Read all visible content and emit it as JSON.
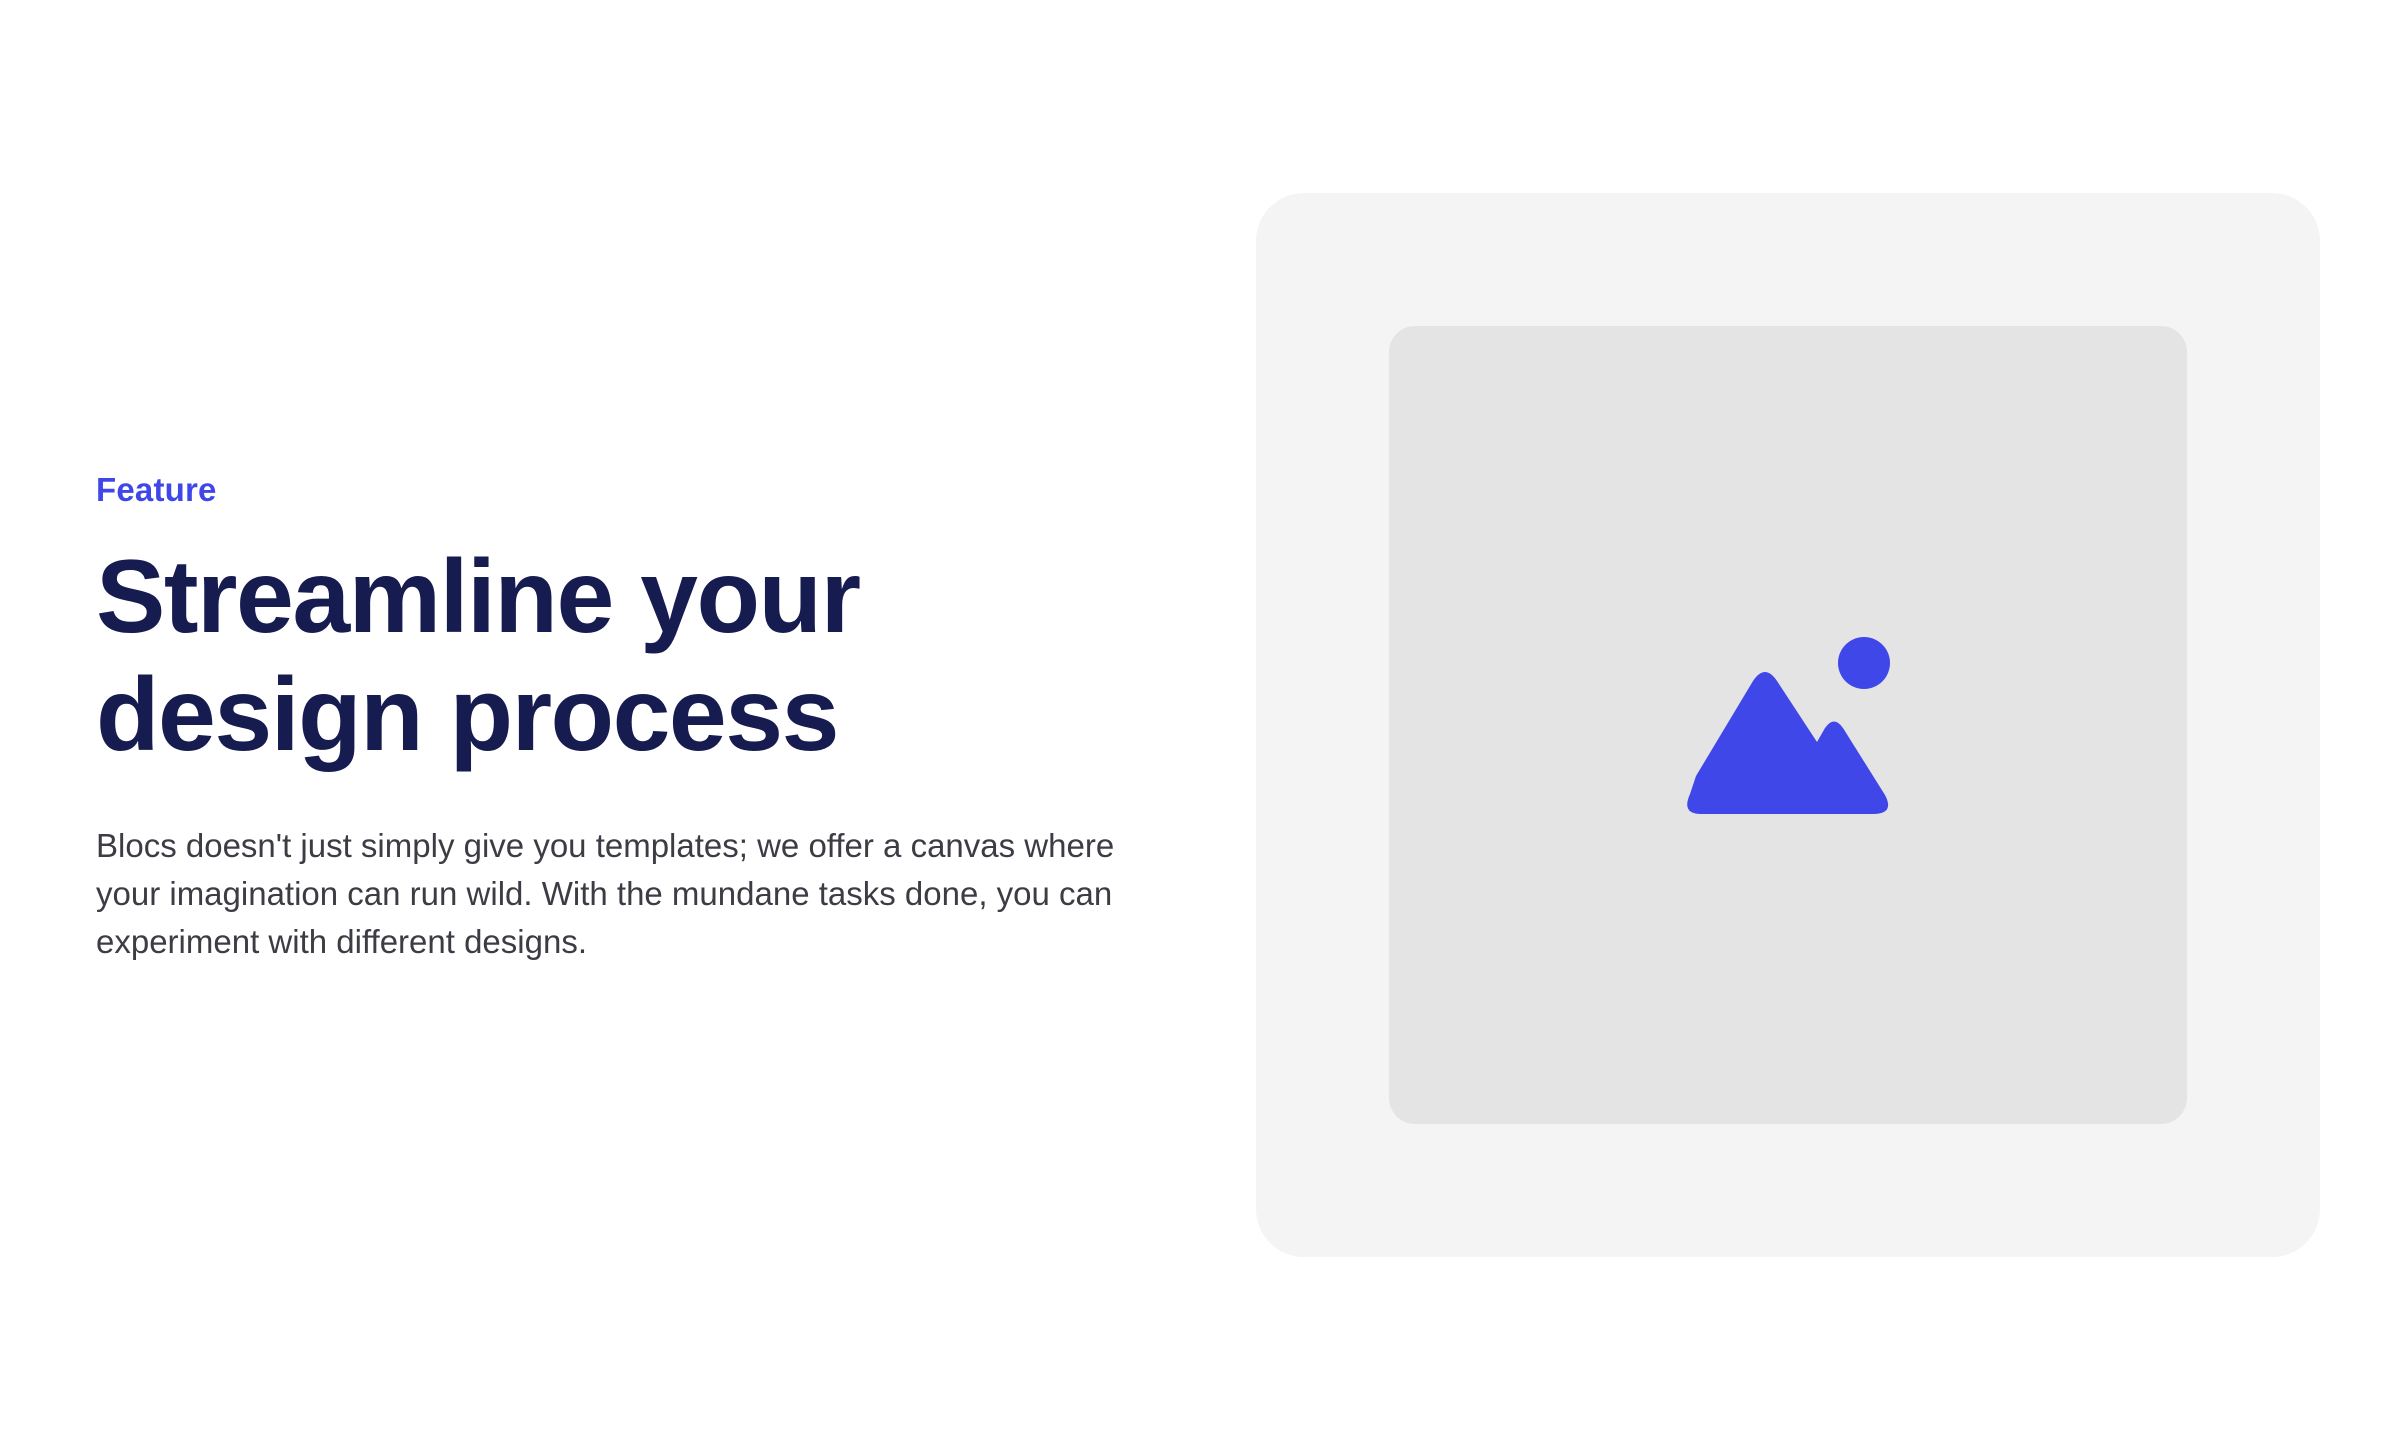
{
  "feature": {
    "eyebrow": "Feature",
    "headline_line1": "Streamline your",
    "headline_line2": "design process",
    "body": "Blocs doesn't just simply give you templates; we offer a canvas where your imagination can run wild. With the mundane tasks done, you can experiment with different designs."
  },
  "media": {
    "icon": "image-placeholder-icon"
  },
  "colors": {
    "accent": "#4047e9",
    "headline": "#161c50",
    "body_text": "#3c3c44",
    "card_bg": "#f4f4f4",
    "frame_bg": "#e4e4e4",
    "page_bg": "#ffffff"
  }
}
